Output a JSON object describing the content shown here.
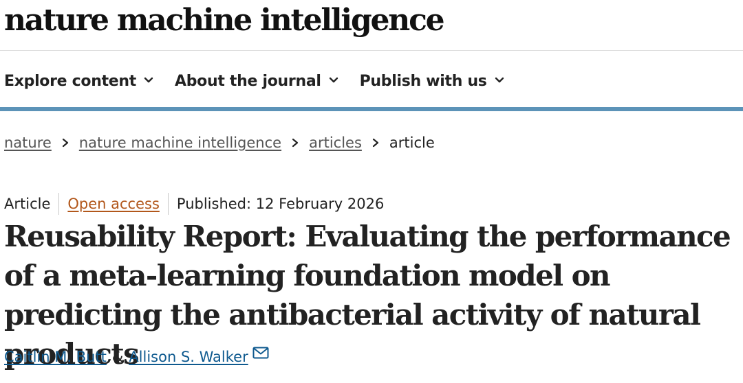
{
  "site": {
    "logo_text": "nature machine intelligence"
  },
  "nav": {
    "items": [
      {
        "label": "Explore content"
      },
      {
        "label": "About the journal"
      },
      {
        "label": "Publish with us"
      }
    ]
  },
  "breadcrumb": {
    "items": [
      {
        "label": "nature"
      },
      {
        "label": "nature machine intelligence"
      },
      {
        "label": "articles"
      },
      {
        "label": "article"
      }
    ]
  },
  "article": {
    "type": "Article",
    "access": "Open access",
    "published": "Published: 12 February 2026",
    "title": "Reusability Report: Evaluating the performance of a meta-learning foundation model on predicting the antibacterial activity of natural products",
    "authors": [
      {
        "name": "Caitlin M. Butt"
      },
      {
        "name": "Allison S. Walker"
      }
    ],
    "author_separator": "&"
  },
  "icons": {
    "nav_dropdown": "chevron-down-icon",
    "breadcrumb_separator": "chevron-right-icon",
    "contact": "mail-icon"
  },
  "colors": {
    "accent_bar": "#5c93b8",
    "open_access": "#b2571b",
    "author_link": "#0f5a8f"
  }
}
